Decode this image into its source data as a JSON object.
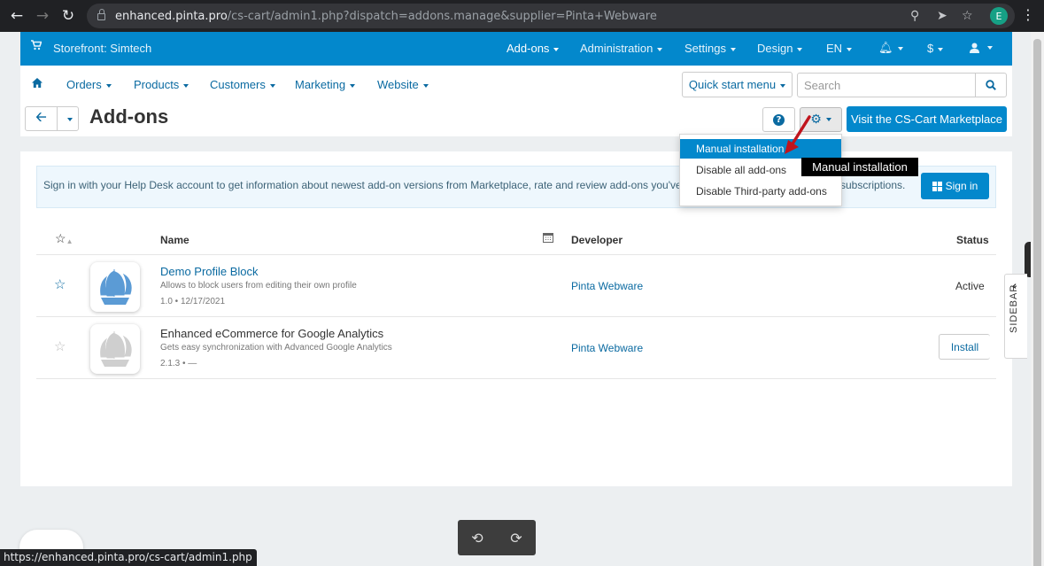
{
  "browser": {
    "url_host": "enhanced.pinta.pro",
    "url_path": "/cs-cart/admin1.php?dispatch=addons.manage&supplier=Pinta+Webware",
    "profile_initial": "E",
    "status_url": "https://enhanced.pinta.pro/cs-cart/admin1.php"
  },
  "topbar": {
    "storefront": "Storefront: Simtech",
    "items": [
      "Add-ons",
      "Administration",
      "Settings",
      "Design",
      "EN",
      "$"
    ]
  },
  "nav": {
    "items": [
      "Orders",
      "Products",
      "Customers",
      "Marketing",
      "Website"
    ],
    "quick_start": "Quick start menu",
    "search_placeholder": "Search"
  },
  "page": {
    "title": "Add-ons",
    "visit_button": "Visit the CS-Cart Marketplace"
  },
  "dropdown": {
    "items": [
      "Manual installation",
      "Disable all add-ons",
      "Disable Third-party add-ons"
    ]
  },
  "tooltip": "Manual installation",
  "notice": {
    "text": "Sign in with your Help Desk account to get information about newest add-on versions from Marketplace, rate and review add-ons you've",
    "text_tail": "subscriptions.",
    "signin": "Sign in"
  },
  "table": {
    "headers": {
      "name": "Name",
      "developer": "Developer",
      "status": "Status"
    },
    "rows": [
      {
        "name": "Demo Profile Block",
        "description": "Allows to block users from editing their own profile",
        "version": "1.0 • 12/17/2021",
        "developer": "Pinta Webware",
        "status": "Active"
      },
      {
        "name": "Enhanced eCommerce for Google Analytics",
        "description": "Gets easy synchronization with Advanced Google Analytics",
        "version": "2.1.3 • —",
        "developer": "Pinta Webware",
        "action": "Install"
      }
    ]
  },
  "sidebar_label": "SIDEBAR",
  "colors": {
    "primary": "#0388cc",
    "link": "#0a6aa1",
    "logo_active": "#5b9bd5",
    "logo_inactive": "#cfcfcf"
  }
}
